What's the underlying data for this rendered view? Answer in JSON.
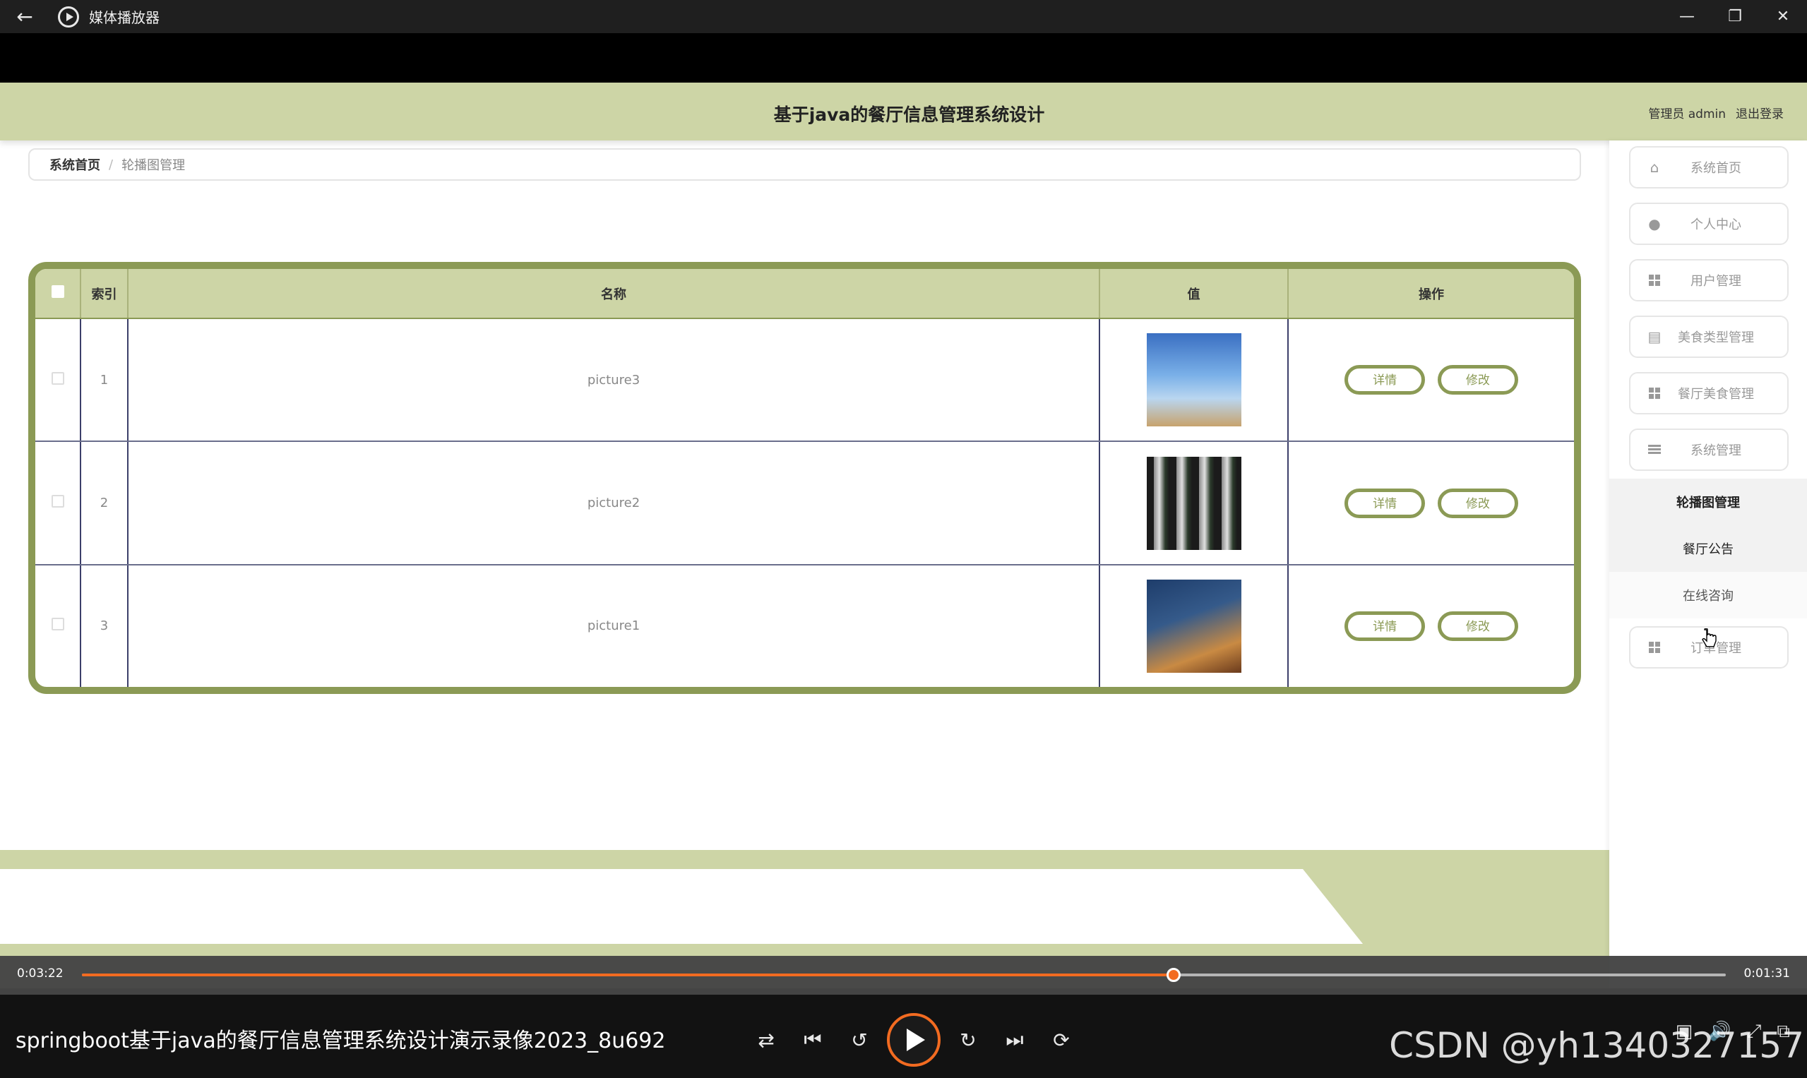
{
  "player": {
    "app_title": "媒体播放器",
    "time_elapsed": "0:03:22",
    "time_remaining": "0:01:31",
    "progress_fraction": 0.664,
    "video_title": "springboot基于java的餐厅信息管理系统设计演示录像2023_8u692",
    "watermark": "CSDN @yh1340327157"
  },
  "site": {
    "title": "基于java的餐厅信息管理系统设计",
    "user_label": "管理员 admin",
    "logout_label": "退出登录"
  },
  "breadcrumb": {
    "home": "系统首页",
    "current": "轮播图管理"
  },
  "table": {
    "columns": [
      "索引",
      "名称",
      "值",
      "操作"
    ],
    "rows": [
      {
        "index": "1",
        "name": "picture3",
        "detail_label": "详情",
        "edit_label": "修改"
      },
      {
        "index": "2",
        "name": "picture2",
        "detail_label": "详情",
        "edit_label": "修改"
      },
      {
        "index": "3",
        "name": "picture1",
        "detail_label": "详情",
        "edit_label": "修改"
      }
    ]
  },
  "sidebar": {
    "items": [
      {
        "label": "系统首页",
        "icon": "home-icon"
      },
      {
        "label": "个人中心",
        "icon": "user-icon"
      },
      {
        "label": "用户管理",
        "icon": "grid-icon"
      },
      {
        "label": "美食类型管理",
        "icon": "clipboard-icon"
      },
      {
        "label": "餐厅美食管理",
        "icon": "grid-icon"
      },
      {
        "label": "系统管理",
        "icon": "list-icon"
      },
      {
        "label": "订单管理",
        "icon": "grid-icon"
      }
    ],
    "submenu": [
      {
        "label": "轮播图管理"
      },
      {
        "label": "餐厅公告"
      },
      {
        "label": "在线咨询"
      }
    ]
  },
  "colors": {
    "accent": "#8b9a55",
    "header_bg": "#cdd5a6",
    "progress": "#f26b21"
  }
}
